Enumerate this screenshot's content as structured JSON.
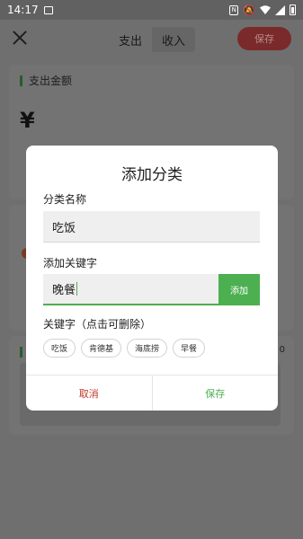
{
  "status_bar": {
    "time": "14:17",
    "icons": [
      "image-icon",
      "nfc-icon",
      "bell-off-icon",
      "wifi-icon",
      "signal-icon",
      "battery-icon"
    ]
  },
  "header": {
    "tabs": [
      {
        "label": "支出"
      },
      {
        "label": "收入"
      }
    ],
    "save_label": "保存"
  },
  "background": {
    "amount_label": "支出金额",
    "currency_symbol": "¥",
    "side_number": "0"
  },
  "dialog": {
    "title": "添加分类",
    "name_label": "分类名称",
    "name_value": "吃饭",
    "keyword_label": "添加关键字",
    "keyword_value": "晚餐",
    "add_button": "添加",
    "keywords_label": "关键字（点击可删除）",
    "keywords": [
      "吃饭",
      "肯德基",
      "海底捞",
      "早餐"
    ],
    "cancel_label": "取消",
    "save_label": "保存"
  },
  "colors": {
    "accent_green": "#4caf50",
    "cancel_red": "#c0392b",
    "overlay": "#6f6f6f"
  }
}
